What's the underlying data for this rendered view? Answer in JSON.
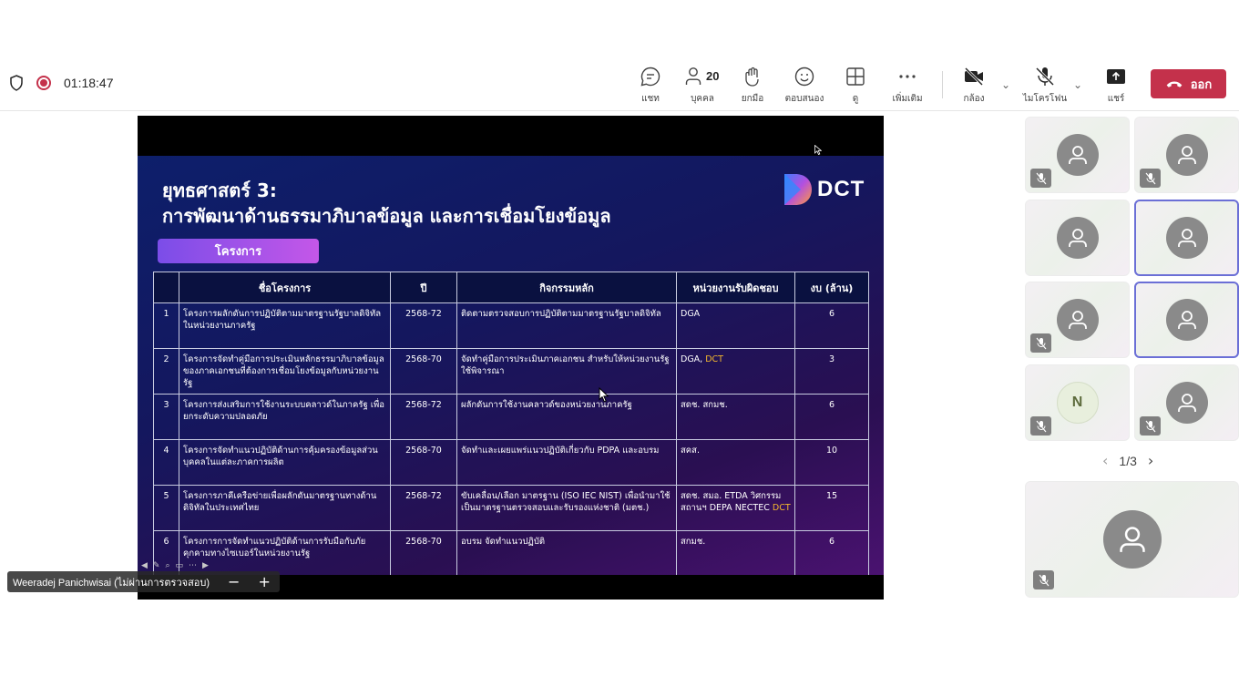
{
  "meeting": {
    "timer": "01:18:47",
    "toolbar": {
      "chat": "แชท",
      "people": "บุคคล",
      "people_count": "20",
      "raise_hand": "ยกมือ",
      "react": "ตอบสนอง",
      "view": "ดู",
      "more": "เพิ่มเติม",
      "camera": "กล้อง",
      "mic": "ไมโครโฟน",
      "share": "แชร์",
      "leave": "ออก"
    },
    "colors": {
      "leave": "#c4314b",
      "active_tile_border": "#6b6fd6"
    }
  },
  "slide": {
    "title_line1": "ยุทธศาสตร์ 3:",
    "title_line2": "การพัฒนาด้านธรรมาภิบาลข้อมูล และการเชื่อมโยงข้อมูล",
    "logo": "DCT",
    "pill": "โครงการ",
    "columns": [
      "",
      "ชื่อโครงการ",
      "ปี",
      "กิจกรรมหลัก",
      "หน่วยงานรับผิดชอบ",
      "งบ (ล้าน)"
    ],
    "rows": [
      {
        "no": "1",
        "name": "โครงการผลักดันการปฏิบัติตามมาตรฐานรัฐบาลดิจิทัลในหน่วยงานภาครัฐ",
        "year": "2568-72",
        "activity": "ติดตามตรวจสอบการปฏิบัติตามมาตรฐานรัฐบาลดิจิทัล",
        "agency": "DGA",
        "agency_hl": "",
        "budget": "6"
      },
      {
        "no": "2",
        "name": "โครงการจัดทำคู่มือการประเมินหลักธรรมาภิบาลข้อมูลของภาคเอกชนที่ต้องการเชื่อมโยงข้อมูลกับหน่วยงานรัฐ",
        "year": "2568-70",
        "activity": "จัดทำคู่มือการประเมินภาคเอกชน สำหรับให้หน่วยงานรัฐใช้พิจารณา",
        "agency": "DGA, ",
        "agency_hl": "DCT",
        "budget": "3"
      },
      {
        "no": "3",
        "name": "โครงการส่งเสริมการใช้งานระบบคลาวด์ในภาครัฐ เพื่อยกระดับความปลอดภัย",
        "year": "2568-72",
        "activity": "ผลักดันการใช้งานคลาวด์ของหน่วยงานภาครัฐ",
        "agency": "สดช. สกมช.",
        "agency_hl": "",
        "budget": "6"
      },
      {
        "no": "4",
        "name": "โครงการจัดทำแนวปฏิบัติด้านการคุ้มครองข้อมูลส่วนบุคคลในแต่ละภาคการผลิต",
        "year": "2568-70",
        "activity": "จัดทำและเผยแพร่แนวปฏิบัติเกี่ยวกับ PDPA และอบรม",
        "agency": "สคส.",
        "agency_hl": "",
        "budget": "10"
      },
      {
        "no": "5",
        "name": "โครงการภาคีเครือข่ายเพื่อผลักดันมาตรฐานทางด้านดิจิทัลในประเทศไทย",
        "year": "2568-72",
        "activity": "ขับเคลื่อน/เลือก มาตรฐาน (ISO IEC NIST) เพื่อนำมาใช้เป็นมาตรฐานตรวจสอบและรับรองแห่งชาติ (มตช.)",
        "agency": "สดช. สมอ. ETDA วิศกรรมสถานฯ DEPA NECTEC ",
        "agency_hl": "DCT",
        "budget": "15"
      },
      {
        "no": "6",
        "name": "โครงการการจัดทำแนวปฏิบัติด้านการรับมือกับภัยคุกคามทางไซเบอร์ในหน่วยงานรัฐ",
        "year": "2568-70",
        "activity": "อบรม จัดทำแนวปฏิบัติ",
        "agency": "สกมช.",
        "agency_hl": "",
        "budget": "6"
      }
    ]
  },
  "presenter": {
    "name": "Weeradej Panichwisai (ไม่ผ่านการตรวจสอบ)",
    "zoom_out": "−",
    "zoom_in": "+"
  },
  "participants": {
    "tiles": [
      {
        "type": "person",
        "muted": true,
        "active": false
      },
      {
        "type": "person",
        "muted": true,
        "active": false
      },
      {
        "type": "person",
        "muted": false,
        "active": false
      },
      {
        "type": "person",
        "muted": false,
        "active": true
      },
      {
        "type": "person",
        "muted": true,
        "active": false
      },
      {
        "type": "person",
        "muted": false,
        "active": true
      },
      {
        "type": "letter",
        "letter": "N",
        "muted": true,
        "active": false
      },
      {
        "type": "person",
        "muted": true,
        "active": false
      }
    ],
    "page": "1/3"
  }
}
